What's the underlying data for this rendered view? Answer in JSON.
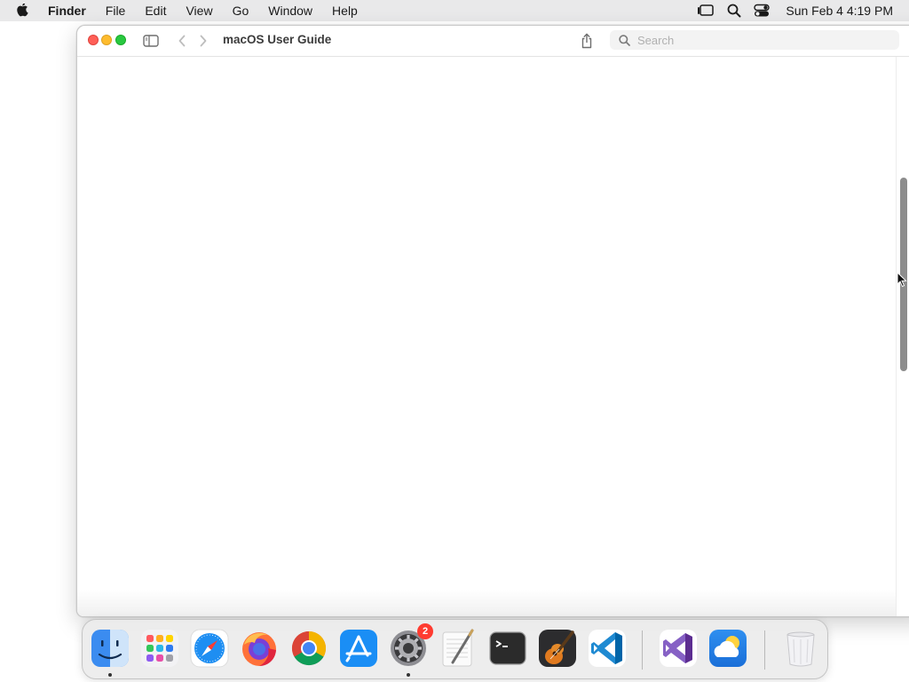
{
  "menubar": {
    "app_name": "Finder",
    "items": [
      {
        "label": "File"
      },
      {
        "label": "Edit"
      },
      {
        "label": "View"
      },
      {
        "label": "Go"
      },
      {
        "label": "Window"
      },
      {
        "label": "Help"
      }
    ],
    "status_icons": [
      "stage-manager-icon",
      "spotlight-search-icon",
      "control-center-icon"
    ],
    "clock": "Sun Feb 4  4:19 PM"
  },
  "window": {
    "title": "macOS User Guide",
    "search": {
      "placeholder": "Search",
      "value": ""
    },
    "scroll_position": 0.38
  },
  "dock": {
    "apps": [
      {
        "name": "Finder",
        "icon": "finder-icon",
        "running": true
      },
      {
        "name": "Launchpad",
        "icon": "launchpad-icon",
        "running": false
      },
      {
        "name": "Safari",
        "icon": "safari-icon",
        "running": false
      },
      {
        "name": "Firefox",
        "icon": "firefox-icon",
        "running": false
      },
      {
        "name": "Google Chrome",
        "icon": "chrome-icon",
        "running": false
      },
      {
        "name": "App Store",
        "icon": "app-store-icon",
        "running": false
      },
      {
        "name": "System Settings",
        "icon": "system-settings-icon",
        "running": true,
        "badge": "2"
      },
      {
        "name": "TextEdit",
        "icon": "textedit-icon",
        "running": false
      },
      {
        "name": "Terminal",
        "icon": "terminal-icon",
        "running": false
      },
      {
        "name": "GarageBand",
        "icon": "garageband-icon",
        "running": false
      },
      {
        "name": "Visual Studio Code",
        "icon": "vscode-icon",
        "running": false
      },
      {
        "name": "Visual Studio",
        "icon": "visual-studio-icon",
        "running": false
      },
      {
        "name": "Weather",
        "icon": "weather-icon",
        "running": false
      },
      {
        "name": "Trash",
        "icon": "trash-icon",
        "running": false
      }
    ]
  },
  "colors": {
    "menubar_bg": "#e9e9ea",
    "close": "#ff5f57",
    "minimize": "#febc2e",
    "maximize": "#28c840",
    "badge": "#ff3b30"
  }
}
